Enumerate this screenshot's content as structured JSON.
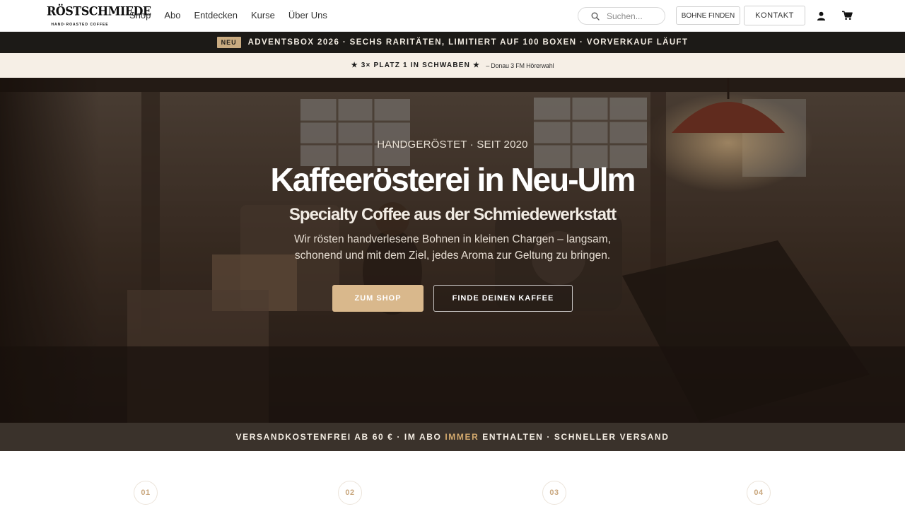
{
  "header": {
    "logo": {
      "wordmark": "RÖSTSCHMIEDE",
      "tagline": "HAND·ROASTED COFFEE"
    },
    "nav": [
      {
        "label": "Shop"
      },
      {
        "label": "Abo"
      },
      {
        "label": "Entdecken"
      },
      {
        "label": "Kurse"
      },
      {
        "label": "Über Uns"
      }
    ],
    "search": {
      "placeholder": "Suchen..."
    },
    "bohne_finden_label": "BOHNE FINDEN",
    "kontakt_label": "KONTAKT",
    "icons": {
      "search": "search-icon",
      "user": "user-icon",
      "cart": "cart-icon"
    }
  },
  "announcement": {
    "badge": "NEU",
    "text": "ADVENTSBOX 2026 · SECHS RARITÄTEN, LIMITIERT AUF 100 BOXEN · VORVERKAUF LÄUFT"
  },
  "award": {
    "main": "★ 3× PLATZ 1 IN SCHWABEN ★",
    "source": "– Donau 3 FM Hörerwahl"
  },
  "hero": {
    "eyebrow": "HANDGERÖSTET · SEIT 2020",
    "title": "Kaffeerösterei in Neu-Ulm",
    "subtitle": "Specialty Coffee aus der Schmiedewerkstatt",
    "description": "Wir rösten handverlesene Bohnen in kleinen Chargen – langsam, schonend und mit dem Ziel, jedes Aroma zur Geltung zu bringen.",
    "cta_primary": "ZUM SHOP",
    "cta_secondary": "FINDE DEINEN KAFFEE"
  },
  "shipping": {
    "text_before": "VERSANDKOSTENFREI AB 60 € · IM ABO ",
    "accent": "IMMER",
    "text_after": " ENTHALTEN · SCHNELLER VERSAND"
  },
  "steps": [
    {
      "number": "01"
    },
    {
      "number": "02"
    },
    {
      "number": "03"
    },
    {
      "number": "04"
    }
  ],
  "colors": {
    "accent": "#d9b88c",
    "dark_bar": "#1c1a17",
    "award_bg": "#f6efe6",
    "ship_bar": "#3a322b",
    "ship_accent": "#d4aa6e"
  }
}
